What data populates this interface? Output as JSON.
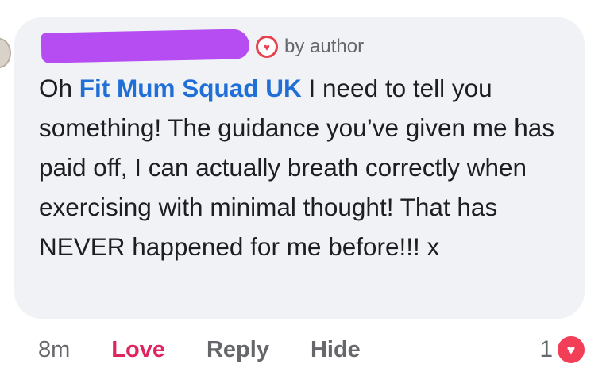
{
  "comment": {
    "author_badge_text": "by author",
    "body_prefix": "Oh ",
    "mention": "Fit Mum Squad UK",
    "body_rest": " I need to tell you something! The guidance you’ve given me has paid off, I can actually breath correctly when exercising with minimal thought! That has NEVER happened for me before!!! x"
  },
  "actions": {
    "time": "8m",
    "love": "Love",
    "reply": "Reply",
    "hide": "Hide"
  },
  "reactions": {
    "count": "1",
    "icon": "heart-icon"
  },
  "colors": {
    "bubble": "#f0f2f5",
    "mention": "#1f6fd6",
    "love": "#e0245e",
    "redaction": "#b64df3",
    "heart": "#f33e58"
  }
}
